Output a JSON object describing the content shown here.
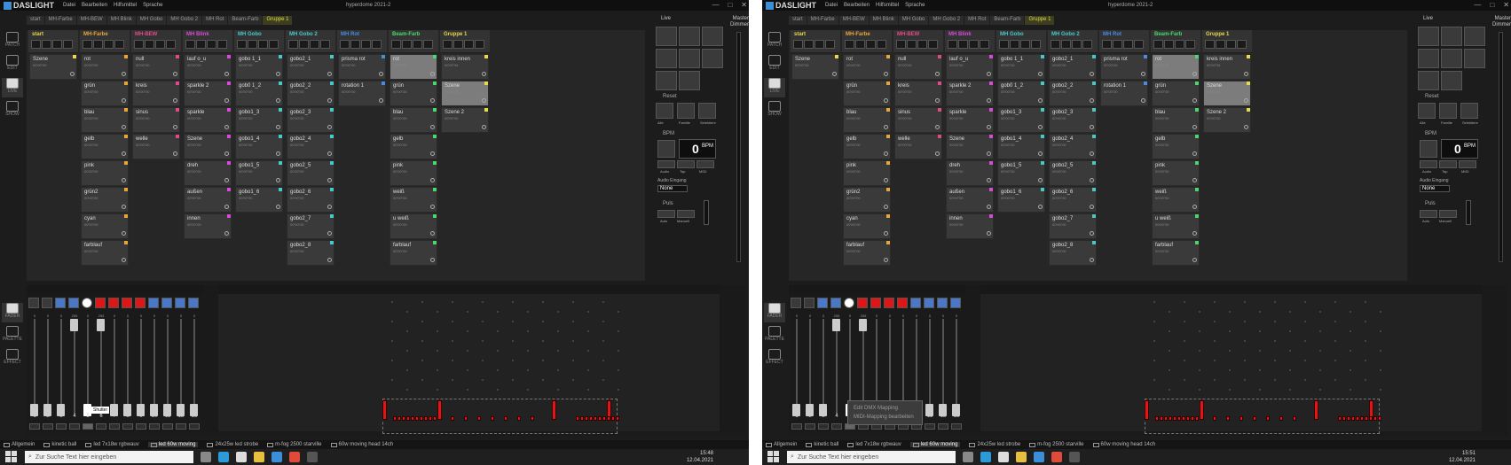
{
  "app": {
    "logo": "DASLIGHT",
    "menu": [
      "Datei",
      "Bearbeiten",
      "Hilfsmittel",
      "Sprache"
    ],
    "window_title": "hyperdome 2021-2",
    "window_buttons": [
      "—",
      "□",
      "✕"
    ]
  },
  "sequence_tabs": [
    "start",
    "MH-Farbe",
    "MH-BEW",
    "MH Blink",
    "MH Gobo",
    "MH Gobo 2",
    "MH Rot",
    "Beam-Farb",
    "Gruppe 1"
  ],
  "left_tools_top": [
    {
      "label": "PATCH",
      "icon": "patch-icon"
    },
    {
      "label": "EDIT",
      "icon": "edit-icon"
    },
    {
      "label": "LIVE",
      "icon": "live-icon",
      "active": true
    },
    {
      "label": "SHOW",
      "icon": "show-icon"
    }
  ],
  "left_tools_bottom": [
    {
      "label": "FADER",
      "icon": "fader-icon",
      "active": true
    },
    {
      "label": "PALETTE",
      "icon": "palette-icon"
    },
    {
      "label": "EFFECT",
      "icon": "effect-icon"
    }
  ],
  "columns": [
    {
      "name": "start",
      "color": "#e8d84a",
      "cues": [
        {
          "name": "Szene",
          "time": "00'00\"00"
        }
      ]
    },
    {
      "name": "MH-Farbe",
      "color": "#e8a53a",
      "cues": [
        {
          "name": "rot",
          "time": "00'00\"00"
        },
        {
          "name": "grün",
          "time": "00'00\"00"
        },
        {
          "name": "blau",
          "time": "00'00\"00"
        },
        {
          "name": "gelb",
          "time": "00'00\"00"
        },
        {
          "name": "pink",
          "time": "00'00\"00"
        },
        {
          "name": "grün2",
          "time": "00'00\"00"
        },
        {
          "name": "cyan",
          "time": "00'00\"00"
        },
        {
          "name": "farblauf",
          "time": "00'00\"00"
        }
      ]
    },
    {
      "name": "MH-BEW",
      "color": "#e04a8a",
      "cues": [
        {
          "name": "null",
          "time": "00'00\"00"
        },
        {
          "name": "kreis",
          "time": "00'00\"00"
        },
        {
          "name": "sinus",
          "time": "00'00\"00"
        },
        {
          "name": "welle",
          "time": "00'00\"00"
        }
      ]
    },
    {
      "name": "MH Blink",
      "color": "#d84ad8",
      "cues": [
        {
          "name": "lauf o_u",
          "time": "00'00\"00"
        },
        {
          "name": "sparkle 2",
          "time": "00'00\"00"
        },
        {
          "name": "sparkle",
          "time": "00'00\"00"
        },
        {
          "name": "Szene",
          "time": "00'00\"00"
        },
        {
          "name": "dreh",
          "time": "00'00\"00"
        },
        {
          "name": "außen",
          "time": "00'00\"00"
        },
        {
          "name": "innen",
          "time": "00'00\"00"
        }
      ]
    },
    {
      "name": "MH Gobo",
      "color": "#4ac8c8",
      "cues": [
        {
          "name": "gobo 1_1",
          "time": "00'00\"00"
        },
        {
          "name": "gob0 1_2",
          "time": "00'00\"00"
        },
        {
          "name": "gobo1_3",
          "time": "00'00\"00"
        },
        {
          "name": "gobo1_4",
          "time": "00'00\"00"
        },
        {
          "name": "gobo1_5",
          "time": "00'00\"00"
        },
        {
          "name": "gobo1_6",
          "time": "00'00\"00"
        }
      ]
    },
    {
      "name": "MH Gobo 2",
      "color": "#4ac8c8",
      "cues": [
        {
          "name": "gobo2_1",
          "time": "00'00\"00"
        },
        {
          "name": "gobo2_2",
          "time": "00'00\"00"
        },
        {
          "name": "gobo2_3",
          "time": "00'00\"00"
        },
        {
          "name": "gobo2_4",
          "time": "00'00\"00"
        },
        {
          "name": "gobo2_5",
          "time": "00'00\"00"
        },
        {
          "name": "gobo2_6",
          "time": "00'00\"00"
        },
        {
          "name": "gobo2_7",
          "time": "00'00\"00"
        },
        {
          "name": "gobo2_8",
          "time": "00'00\"00"
        }
      ]
    },
    {
      "name": "MH Rot",
      "color": "#4a8ae0",
      "cues": [
        {
          "name": "prisma rot",
          "time": "00'00\"00"
        },
        {
          "name": "rotation 1",
          "time": "00'00\"00"
        }
      ]
    },
    {
      "name": "Beam-Farb",
      "color": "#4ad86a",
      "cues": [
        {
          "name": "rot",
          "time": "00'00\"38",
          "active": true
        },
        {
          "name": "grün",
          "time": "00'00\"00"
        },
        {
          "name": "blau",
          "time": "00'00\"00"
        },
        {
          "name": "gelb",
          "time": "00'00\"00"
        },
        {
          "name": "pink",
          "time": "00'00\"00"
        },
        {
          "name": "weiß",
          "time": "00'00\"00"
        },
        {
          "name": "u weiß",
          "time": "00'00\"00"
        },
        {
          "name": "farblauf",
          "time": "00'00\"00"
        }
      ]
    },
    {
      "name": "Gruppe 1",
      "color": "#e8d84a",
      "cues": [
        {
          "name": "kreis innen",
          "time": "00'00\"94"
        },
        {
          "name": "Szene",
          "time": "00'00\"38",
          "active": true
        },
        {
          "name": "Szene 2",
          "time": "00'00\"00"
        }
      ]
    }
  ],
  "live_panel": {
    "title": "Live",
    "master": "Master",
    "dimmer": "Dimmer",
    "reset": "Reset",
    "reset_labels": [
      "Alle",
      "Familie",
      "Selektiere"
    ],
    "bpm_title": "BPM",
    "bpm_value": "0",
    "bpm_unit": "BPM",
    "bpm_labels": [
      "Audio",
      "Tap",
      "MIDI"
    ],
    "audio_label": "Audio Eingang",
    "audio_value": "None",
    "puls_title": "Puls",
    "puls_labels": [
      "Auto",
      "Manuell"
    ]
  },
  "faders": {
    "numbers": [
      "1",
      "2",
      "3",
      "4",
      "5",
      "6",
      "7",
      "8",
      "9",
      "10",
      "11",
      "12",
      "13"
    ],
    "values": [
      "0",
      "0",
      "0",
      "255",
      "0",
      "255",
      "0",
      "0",
      "0",
      "0",
      "0",
      "0",
      "0"
    ],
    "on_labels": [
      "Off",
      "Off",
      "Off",
      "Off",
      "On",
      "Off",
      "Off",
      "Off",
      "Off",
      "Off",
      "Off",
      "Off",
      "Off"
    ],
    "tooltip": "Shutter"
  },
  "context_menu": [
    "Edit DMX Mapping",
    "MIDI-Mapping bearbeiten"
  ],
  "fixture_tabs": [
    "Allgemein",
    "kinetic ball",
    "led 7x18w rgbwauv",
    "led 60w moving",
    "24x25w led strobe",
    "m-fog 2500 starville",
    "60w moving head 14ch"
  ],
  "fixture_tab_active": "led 60w moving",
  "taskbar": {
    "search_placeholder": "Zur Suche Text hier eingeben",
    "time_a": "15:48",
    "time_b": "15:51",
    "date": "12.04.2021"
  },
  "colors": {
    "accent_yellow": "#dede40",
    "red_cell": "#e01515",
    "bg": "#1c1c1c"
  }
}
